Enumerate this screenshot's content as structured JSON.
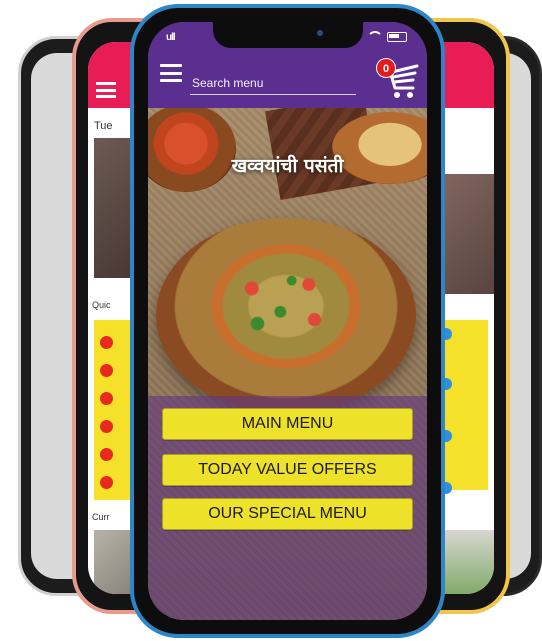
{
  "app": {
    "search_placeholder": "Search menu",
    "cart_count": "0",
    "hero_title": "खव्वयांची पसंती",
    "menu_buttons": [
      "MAIN MENU",
      "TODAY VALUE OFFERS",
      "OUR SPECIAL MENU"
    ]
  },
  "status_bar": {
    "signal": "ull"
  },
  "back_phone_left": {
    "partial_text_1": "Tue",
    "partial_text_2": "Quic",
    "partial_text_3": "Curr"
  },
  "colors": {
    "header_purple": "#5a2f8f",
    "button_yellow": "#eee12a",
    "back_header_red": "#e81d56",
    "frame_blue": "#2e86c8"
  },
  "icons": [
    "hamburger-icon",
    "cart-icon",
    "wifi-icon",
    "battery-icon"
  ]
}
